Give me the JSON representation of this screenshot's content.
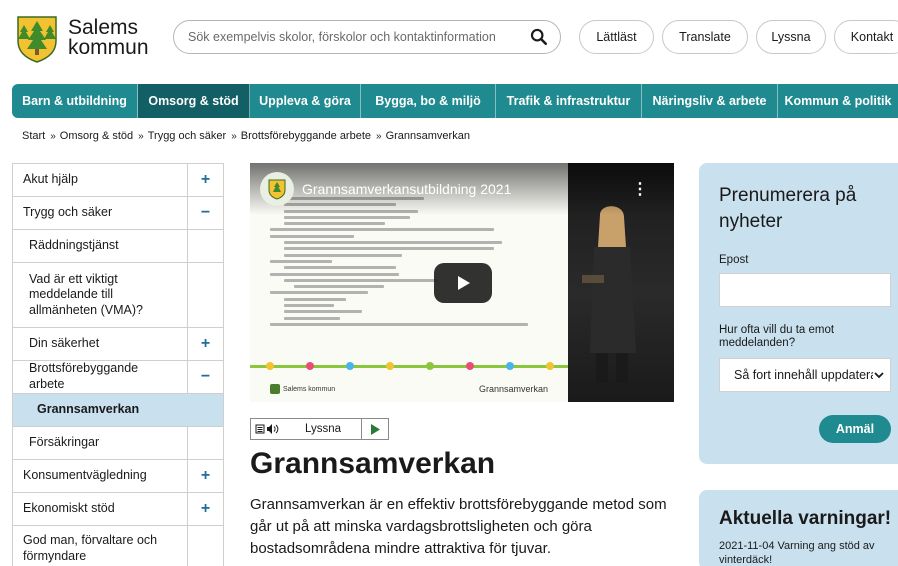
{
  "brand": {
    "line1": "Salems",
    "line2": "kommun",
    "primary_color": "#1f8a8f",
    "dark_color": "#135f66",
    "light_color": "#c9e0ee"
  },
  "search": {
    "placeholder": "Sök exempelvis skolor, förskolor och kontaktinformation"
  },
  "header_links": [
    {
      "label": "Lättläst"
    },
    {
      "label": "Translate"
    },
    {
      "label": "Lyssna"
    },
    {
      "label": "Kontakt"
    }
  ],
  "nav": [
    {
      "label": "Barn & utbildning"
    },
    {
      "label": "Omsorg & stöd",
      "active": true
    },
    {
      "label": "Uppleva & göra"
    },
    {
      "label": "Bygga, bo & miljö"
    },
    {
      "label": "Trafik & infrastruktur"
    },
    {
      "label": "Näringsliv & arbete"
    },
    {
      "label": "Kommun & politik"
    }
  ],
  "breadcrumb": [
    "Start",
    "Omsorg & stöd",
    "Trygg och säker",
    "Brottsförebyggande arbete",
    "Grannsamverkan"
  ],
  "sidebar": [
    {
      "label": "Akut hjälp",
      "toggle": "+"
    },
    {
      "label": "Trygg och säker",
      "toggle": "−"
    },
    {
      "label": "Räddningstjänst",
      "toggle": ""
    },
    {
      "label": "Vad är ett viktigt meddelande till allmänheten (VMA)?",
      "toggle": ""
    },
    {
      "label": "Din säkerhet",
      "toggle": "+"
    },
    {
      "label": "Brottsförebyggande arbete",
      "toggle": "−"
    },
    {
      "label": "Grannsamverkan",
      "toggle": ""
    },
    {
      "label": "Försäkringar",
      "toggle": ""
    },
    {
      "label": "Konsumentvägledning",
      "toggle": "+"
    },
    {
      "label": "Ekonomiskt stöd",
      "toggle": "+"
    },
    {
      "label": "God man, förvaltare och förmyndare",
      "toggle": ""
    }
  ],
  "video": {
    "title": "Grannsamverkansutbildning 2021",
    "slide_footer": "Grannsamverkan",
    "slide_logo_text": "Salems kommun"
  },
  "listen": {
    "label": "Lyssna"
  },
  "page": {
    "title": "Grannsamverkan",
    "intro": "Grannsamverkan är en effektiv brottsförebyggande metod som går ut på att minska vardagsbrottsligheten och göra bostadsområdena mindre attraktiva för tjuvar."
  },
  "subscribe": {
    "title": "Prenumerera på nyheter",
    "email_label": "Epost",
    "frequency_label": "Hur ofta vill du ta emot meddelanden?",
    "frequency_value": "Så fort innehåll uppdateras",
    "submit": "Anmäl"
  },
  "warnings": {
    "title": "Aktuella varningar!",
    "item": "2021-11-04 Varning ang stöd av vinterdäck!"
  }
}
